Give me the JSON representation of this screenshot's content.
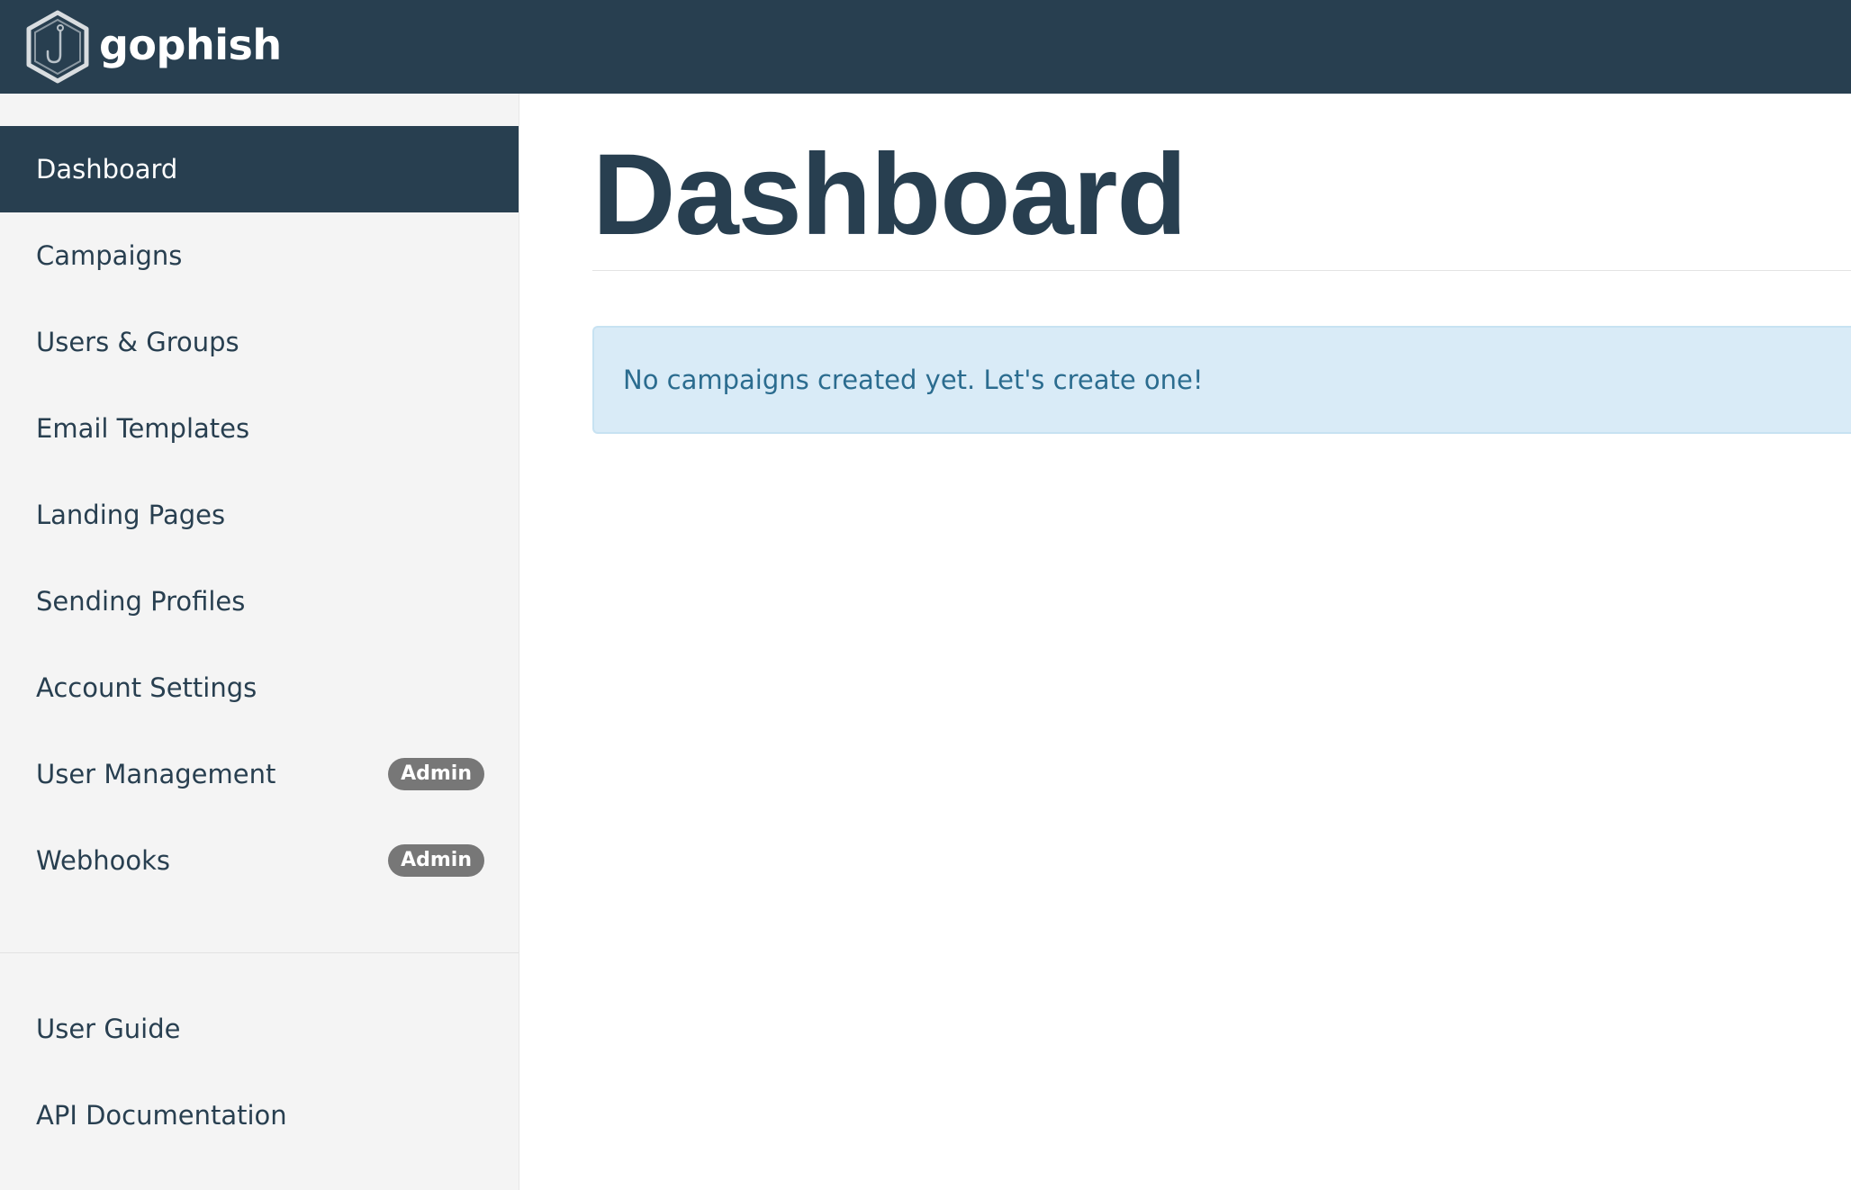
{
  "app": {
    "brand": "gophish"
  },
  "sidebar": {
    "items": [
      {
        "label": "Dashboard",
        "active": true
      },
      {
        "label": "Campaigns"
      },
      {
        "label": "Users & Groups"
      },
      {
        "label": "Email Templates"
      },
      {
        "label": "Landing Pages"
      },
      {
        "label": "Sending Profiles"
      },
      {
        "label": "Account Settings"
      },
      {
        "label": "User Management",
        "badge": "Admin"
      },
      {
        "label": "Webhooks",
        "badge": "Admin"
      }
    ],
    "secondary": [
      {
        "label": "User Guide"
      },
      {
        "label": "API Documentation"
      }
    ]
  },
  "main": {
    "title": "Dashboard",
    "alert": "No campaigns created yet. Let's create one!"
  },
  "colors": {
    "navbar": "#283f50",
    "sidebar_bg": "#f4f4f4",
    "alert_bg": "#d9ebf7",
    "alert_text": "#2b6c8f",
    "badge_bg": "#777777"
  }
}
